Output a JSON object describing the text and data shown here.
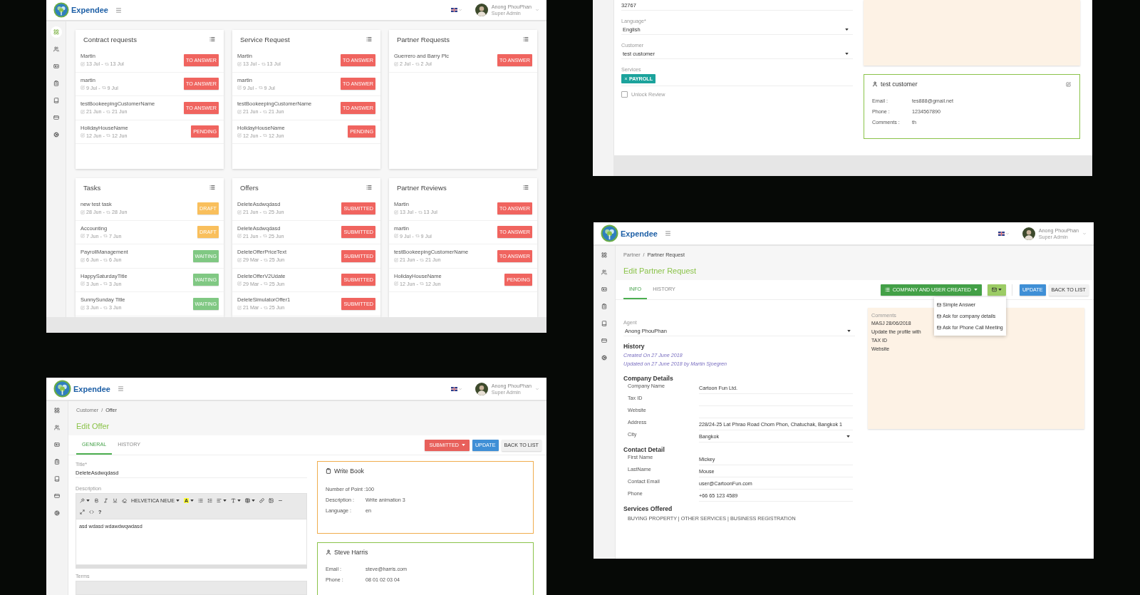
{
  "dashboard": {
    "header": {
      "brand": "Expendee",
      "user_name": "Anong PhouPhan",
      "user_role": "Super Admin"
    },
    "sidebar": [
      {
        "selected": true
      },
      {
        "selected": false
      },
      {
        "selected": false
      },
      {
        "selected": false
      },
      {
        "selected": false
      },
      {
        "selected": false
      },
      {
        "selected": false
      }
    ],
    "date_separator": "-",
    "panels": [
      {
        "title": "Contract requests",
        "items": [
          {
            "name": "Martin",
            "created": "13 Jul",
            "updated": "13 Jul",
            "status": "TO ANSWER",
            "color": "#f0645f"
          },
          {
            "name": "martin",
            "created": "9 Jul",
            "updated": "9 Jul",
            "status": "TO ANSWER",
            "color": "#f0645f"
          },
          {
            "name": "testBookeepingCustomerName",
            "created": "21 Jun",
            "updated": "21 Jun",
            "status": "TO ANSWER",
            "color": "#f0645f"
          },
          {
            "name": "HolidayHouseName",
            "created": "12 Jun",
            "updated": "12 Jun",
            "status": "PENDING",
            "color": "#f0645f"
          }
        ]
      },
      {
        "title": "Service Request",
        "items": [
          {
            "name": "Martin",
            "created": "13 Jul",
            "updated": "13 Jul",
            "status": "TO ANSWER",
            "color": "#f0645f"
          },
          {
            "name": "martin",
            "created": "9 Jul",
            "updated": "9 Jul",
            "status": "TO ANSWER",
            "color": "#f0645f"
          },
          {
            "name": "testBookeepingCustomerName",
            "created": "21 Jun",
            "updated": "21 Jun",
            "status": "TO ANSWER",
            "color": "#f0645f"
          },
          {
            "name": "HolidayHouseName",
            "created": "12 Jun",
            "updated": "12 Jun",
            "status": "PENDING",
            "color": "#f0645f"
          }
        ]
      },
      {
        "title": "Partner Requests",
        "items": [
          {
            "name": "Guerrero and Barry Plc",
            "created": "2 Jul",
            "updated": "2 Jul",
            "status": "TO ANSWER",
            "color": "#f0645f"
          }
        ]
      },
      {
        "title": "Tasks",
        "items": [
          {
            "name": "new test task",
            "created": "28 Jun",
            "updated": "28 Jun",
            "status": "DRAFT",
            "color": "#f9bf5c"
          },
          {
            "name": "Accounting",
            "created": "7 Jun",
            "updated": "7 Jun",
            "status": "DRAFT",
            "color": "#f9bf5c"
          },
          {
            "name": "PayrollManagement",
            "created": "6 Jun",
            "updated": "6 Jun",
            "status": "WAITING",
            "color": "#80c883"
          },
          {
            "name": "HappySaturdayTitle",
            "created": "3 Jun",
            "updated": "3 Jun",
            "status": "WAITING",
            "color": "#80c883"
          },
          {
            "name": "SunnySunday Title",
            "created": "3 Jun",
            "updated": "3 Jun",
            "status": "WAITING",
            "color": "#80c883"
          }
        ]
      },
      {
        "title": "Offers",
        "items": [
          {
            "name": "DeleteAsdwqdasd",
            "created": "21 Jun",
            "updated": "25 Jun",
            "status": "SUBMITTED",
            "color": "#f0645f"
          },
          {
            "name": "DeleteAsdwqdasd",
            "created": "21 Jun",
            "updated": "25 Jun",
            "status": "SUBMITTED",
            "color": "#f0645f"
          },
          {
            "name": "DeleteOfferPriceText",
            "created": "29 Mar",
            "updated": "25 Jun",
            "status": "SUBMITTED",
            "color": "#f0645f"
          },
          {
            "name": "DeleteOfferV2Udate",
            "created": "29 Mar",
            "updated": "25 Jun",
            "status": "SUBMITTED",
            "color": "#f0645f"
          },
          {
            "name": "DeleteSimulatorOffer1",
            "created": "21 Mar",
            "updated": "25 Jun",
            "status": "SUBMITTED",
            "color": "#f0645f"
          }
        ]
      },
      {
        "title": "Partner Reviews",
        "items": [
          {
            "name": "Martin",
            "created": "13 Jul",
            "updated": "13 Jul",
            "status": "TO ANSWER",
            "color": "#f0645f"
          },
          {
            "name": "martin",
            "created": "9 Jul",
            "updated": "9 Jul",
            "status": "TO ANSWER",
            "color": "#f0645f"
          },
          {
            "name": "testBookeepingCustomerName",
            "created": "21 Jun",
            "updated": "21 Jun",
            "status": "TO ANSWER",
            "color": "#f0645f"
          },
          {
            "name": "HolidayHouseName",
            "created": "12 Jun",
            "updated": "12 Jun",
            "status": "PENDING",
            "color": "#f0645f"
          }
        ]
      }
    ]
  },
  "customer_form": {
    "fields": [
      {
        "kind": "text",
        "value": "32767"
      },
      {
        "kind": "select",
        "label": "Language*",
        "value": "English"
      },
      {
        "kind": "select",
        "label": "Customer",
        "value": "test customer"
      },
      {
        "kind": "tags",
        "label": "Services",
        "tags": [
          "PAYROLL"
        ]
      },
      {
        "kind": "checkbox",
        "label": "Unlock Review",
        "checked": false
      }
    ],
    "card": {
      "kind": "person",
      "title": "test customer",
      "editable": true,
      "rows": [
        {
          "label": "Email :",
          "value": "tes888@gmail.net"
        },
        {
          "label": "Phone :",
          "value": "1234567890"
        },
        {
          "label": "Comments :",
          "value": "th"
        }
      ]
    }
  },
  "partner_request": {
    "header": {
      "brand": "Expendee",
      "user_name": "Anong PhouPhan",
      "user_role": "Super Admin"
    },
    "sidebar": [
      {
        "selected": false
      },
      {
        "selected": false
      },
      {
        "selected": false
      },
      {
        "selected": false
      },
      {
        "selected": false
      },
      {
        "selected": false
      },
      {
        "selected": false
      }
    ],
    "breadcrumb": {
      "items": [
        "Partner",
        "Partner Request"
      ],
      "separator": "/"
    },
    "title": "Edit Partner Request",
    "tabs": [
      {
        "label": "INFO",
        "selected": true
      },
      {
        "label": "HISTORY",
        "selected": false
      }
    ],
    "status_button": {
      "label": "COMPANY AND USER CREATED",
      "kind": "success"
    },
    "mail_menu": {
      "expanded": true,
      "items": [
        "Simple Answer",
        "Ask for company details",
        "Ask for Phone Call Meeting"
      ]
    },
    "actions": [
      {
        "label": "UPDATE",
        "kind": "primary"
      },
      {
        "label": "BACK TO LIST",
        "kind": "default"
      }
    ],
    "agent": {
      "label": "Agent",
      "value": "Anong PhouPhan"
    },
    "history": {
      "heading": "History",
      "entries": [
        "Created On 27 June 2018",
        "Updated on 27 June 2018 by Martin Sjoegren"
      ]
    },
    "sections": [
      {
        "heading": "Company Details",
        "rows": [
          {
            "kind": "text",
            "label": "Company Name",
            "value": "Cartoon Fun Ltd."
          },
          {
            "kind": "text",
            "label": "Tax ID"
          },
          {
            "kind": "text",
            "label": "Website"
          },
          {
            "kind": "text",
            "label": "Address",
            "value": "228/24-25 Lat Phrao Road Chom Phon, Chatuchak, Bangkok 1"
          },
          {
            "kind": "select",
            "label": "City",
            "value": "Bangkok"
          }
        ]
      },
      {
        "heading": "Contact Detail",
        "rows": [
          {
            "kind": "text",
            "label": "First Name",
            "value": "Mickey"
          },
          {
            "kind": "text",
            "label": "LastName",
            "value": "Mouse"
          },
          {
            "kind": "text",
            "label": "Contact Email",
            "value": "user@CartoonFun.com"
          },
          {
            "kind": "text",
            "label": "Phone",
            "value": "+66 65 123 4589"
          }
        ]
      }
    ],
    "services": {
      "heading": "Services Offered",
      "text": "BUYING PROPERTY | OTHER SERVICES | BUSINESS REGISTRATION"
    },
    "comments": {
      "label": "Comments",
      "lines": [
        "MASJ 28/06/2018",
        "Update the profile with",
        "TAX ID",
        "Website"
      ]
    }
  },
  "offer": {
    "header": {
      "brand": "Expendee",
      "user_name": "Anong PhouPhan",
      "user_role": "Super Admin"
    },
    "sidebar": [
      {
        "selected": false
      },
      {
        "selected": false
      },
      {
        "selected": false
      },
      {
        "selected": false
      },
      {
        "selected": false
      },
      {
        "selected": false
      },
      {
        "selected": false
      }
    ],
    "breadcrumb": {
      "items": [
        "Customer",
        "Offer"
      ],
      "separator": "/"
    },
    "title": "Edit Offer",
    "tabs": [
      {
        "label": "GENERAL",
        "selected": true
      },
      {
        "label": "HISTORY",
        "selected": false
      }
    ],
    "status_button": {
      "label": "SUBMITTED",
      "kind": "danger"
    },
    "actions": [
      {
        "label": "UPDATE",
        "kind": "primary"
      },
      {
        "label": "BACK TO LIST",
        "kind": "default"
      }
    ],
    "title_field": {
      "label": "Title*",
      "value": "DeleteAsdwqdasd"
    },
    "description": {
      "label": "Description",
      "font": "HELVETICA NEUE",
      "color_button": "A",
      "help": "?",
      "text": "asd wdasd wdawdwqwdasd"
    },
    "terms": {
      "label": "Terms"
    },
    "cards": [
      {
        "kind": "item",
        "title": "Write Book",
        "editable": false,
        "rows": [
          {
            "label": "Number of Point :",
            "value": "100"
          },
          {
            "label": "Description :",
            "value": "Write animation 3"
          },
          {
            "label": "Language :",
            "value": "en"
          }
        ]
      },
      {
        "kind": "person",
        "title": "Steve Harris",
        "editable": false,
        "rows": [
          {
            "label": "Email :",
            "value": "steve@harris.com"
          },
          {
            "label": "Phone :",
            "value": "08 01 02 03 04"
          }
        ]
      }
    ]
  }
}
